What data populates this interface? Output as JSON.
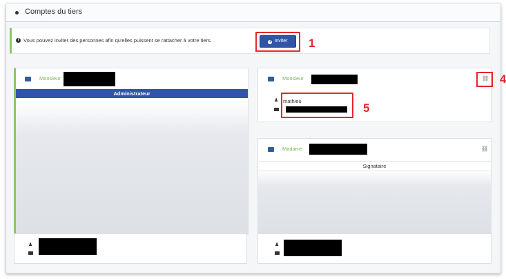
{
  "section": {
    "title": "Comptes du tiers"
  },
  "info": {
    "text": "Vous pouvez inviter des personnes afin qu'elles puissent se rattacher à votre tiers.",
    "invite_label": "Inviter"
  },
  "cards": [
    {
      "civility": "Monsieur",
      "role": "Administrateur"
    },
    {
      "civility": "Monsieur",
      "username": "mathieu"
    },
    {
      "civility": "Madame",
      "role": "Signataire"
    }
  ],
  "annotations": [
    "1",
    "4",
    "5"
  ],
  "colors": {
    "accent_blue": "#2f54a8",
    "civility_green": "#76b655",
    "annotation_red": "#e8262e"
  },
  "icons": [
    "info-icon",
    "plus-icon",
    "id-card-icon",
    "person-icon",
    "mail-icon",
    "unlink-icon"
  ]
}
